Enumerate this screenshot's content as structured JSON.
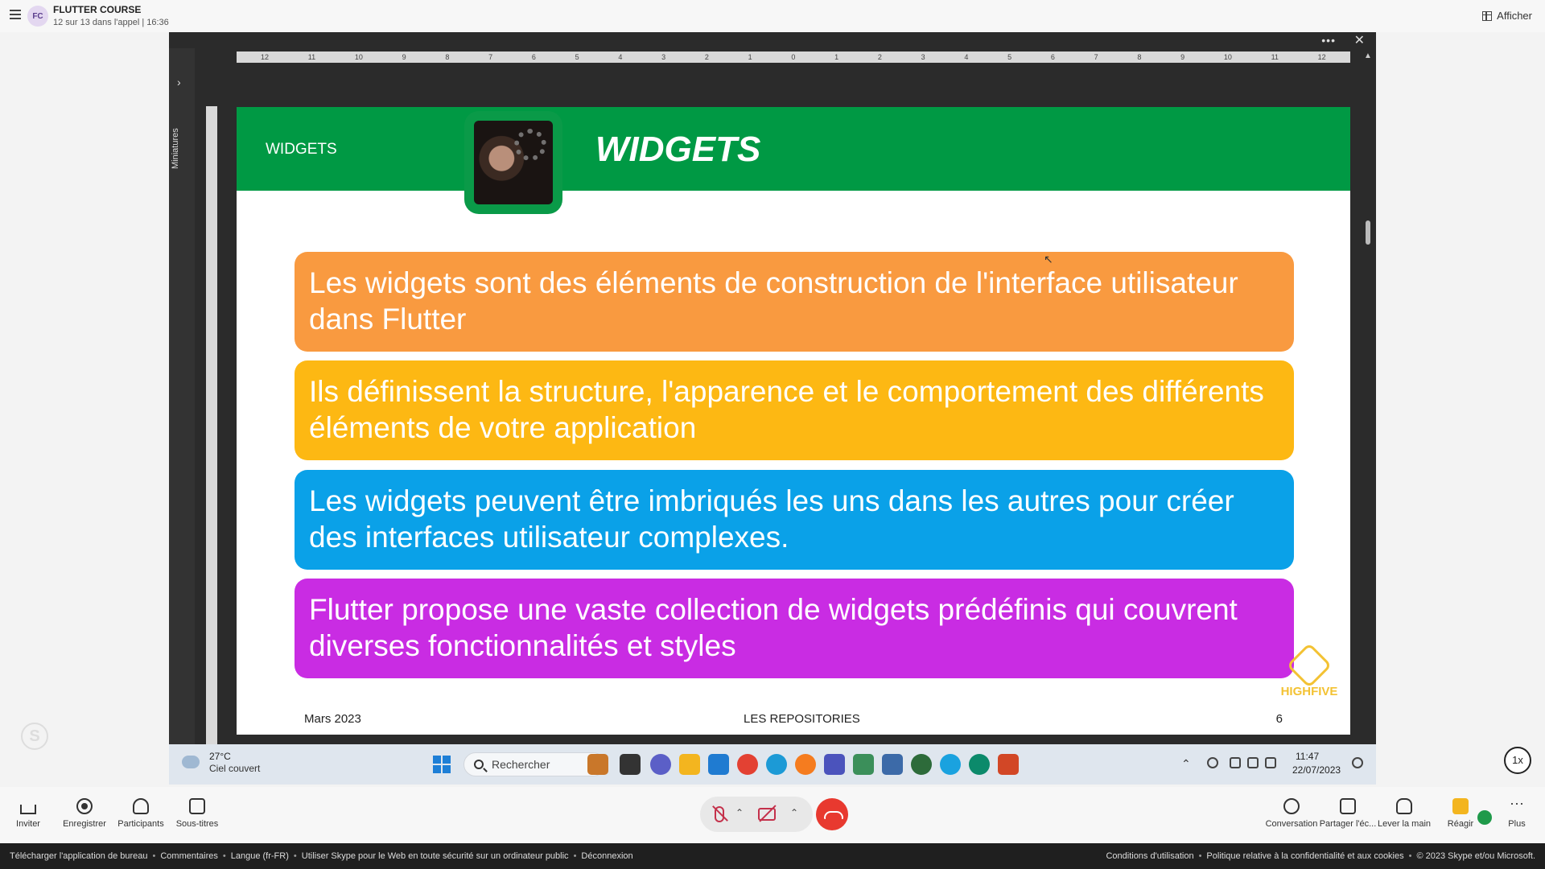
{
  "header": {
    "avatar_initials": "FC",
    "title": "FLUTTER COURSE",
    "subtitle": "12 sur 13 dans l'appel | 16:36",
    "view_label": "Afficher"
  },
  "ppt": {
    "thumbnails_label": "Miniatures",
    "ruler_h": [
      "12",
      "11",
      "10",
      "9",
      "8",
      "7",
      "6",
      "5",
      "4",
      "3",
      "2",
      "1",
      "0",
      "1",
      "2",
      "3",
      "4",
      "5",
      "6",
      "7",
      "8",
      "9",
      "10",
      "11",
      "12"
    ]
  },
  "slide": {
    "header_small": "WIDGETS",
    "title": "WIDGETS",
    "bullets": [
      "Les widgets sont des éléments de construction de l'interface utilisateur dans Flutter",
      "Ils définissent la structure, l'apparence et le comportement des différents éléments de votre application",
      "Les widgets peuvent être imbriqués les uns dans les autres pour créer des interfaces utilisateur complexes.",
      "Flutter propose une vaste collection de widgets prédéfinis qui couvrent diverses fonctionnalités et styles"
    ],
    "footer_left": "Mars 2023",
    "footer_mid": "LES REPOSITORIES",
    "footer_right": "6",
    "logo_text": "HIGHFIVE"
  },
  "taskbar": {
    "temp": "27°C",
    "weather": "Ciel couvert",
    "search_placeholder": "Rechercher",
    "time": "11:47",
    "date": "22/07/2023"
  },
  "playback_speed": "1x",
  "controls": {
    "invite": "Inviter",
    "record": "Enregistrer",
    "participants": "Participants",
    "subtitles": "Sous-titres",
    "conversation": "Conversation",
    "share_screen": "Partager l'éc...",
    "raise_hand": "Lever la main",
    "react": "Réagir",
    "more": "Plus"
  },
  "footer": {
    "download": "Télécharger l'application de bureau",
    "comments": "Commentaires",
    "language": "Langue (fr-FR)",
    "safe_use": "Utiliser Skype pour le Web en toute sécurité sur un ordinateur public",
    "logout": "Déconnexion",
    "terms": "Conditions d'utilisation",
    "privacy": "Politique relative à la confidentialité et aux cookies",
    "copyright": "© 2023 Skype et/ou Microsoft."
  },
  "colors": {
    "slide_header": "#009944",
    "bullet_1": "#f99a40",
    "bullet_2": "#fdb813",
    "bullet_3": "#0aa1e8",
    "bullet_4": "#c92ce3",
    "hangup": "#e8392f"
  }
}
